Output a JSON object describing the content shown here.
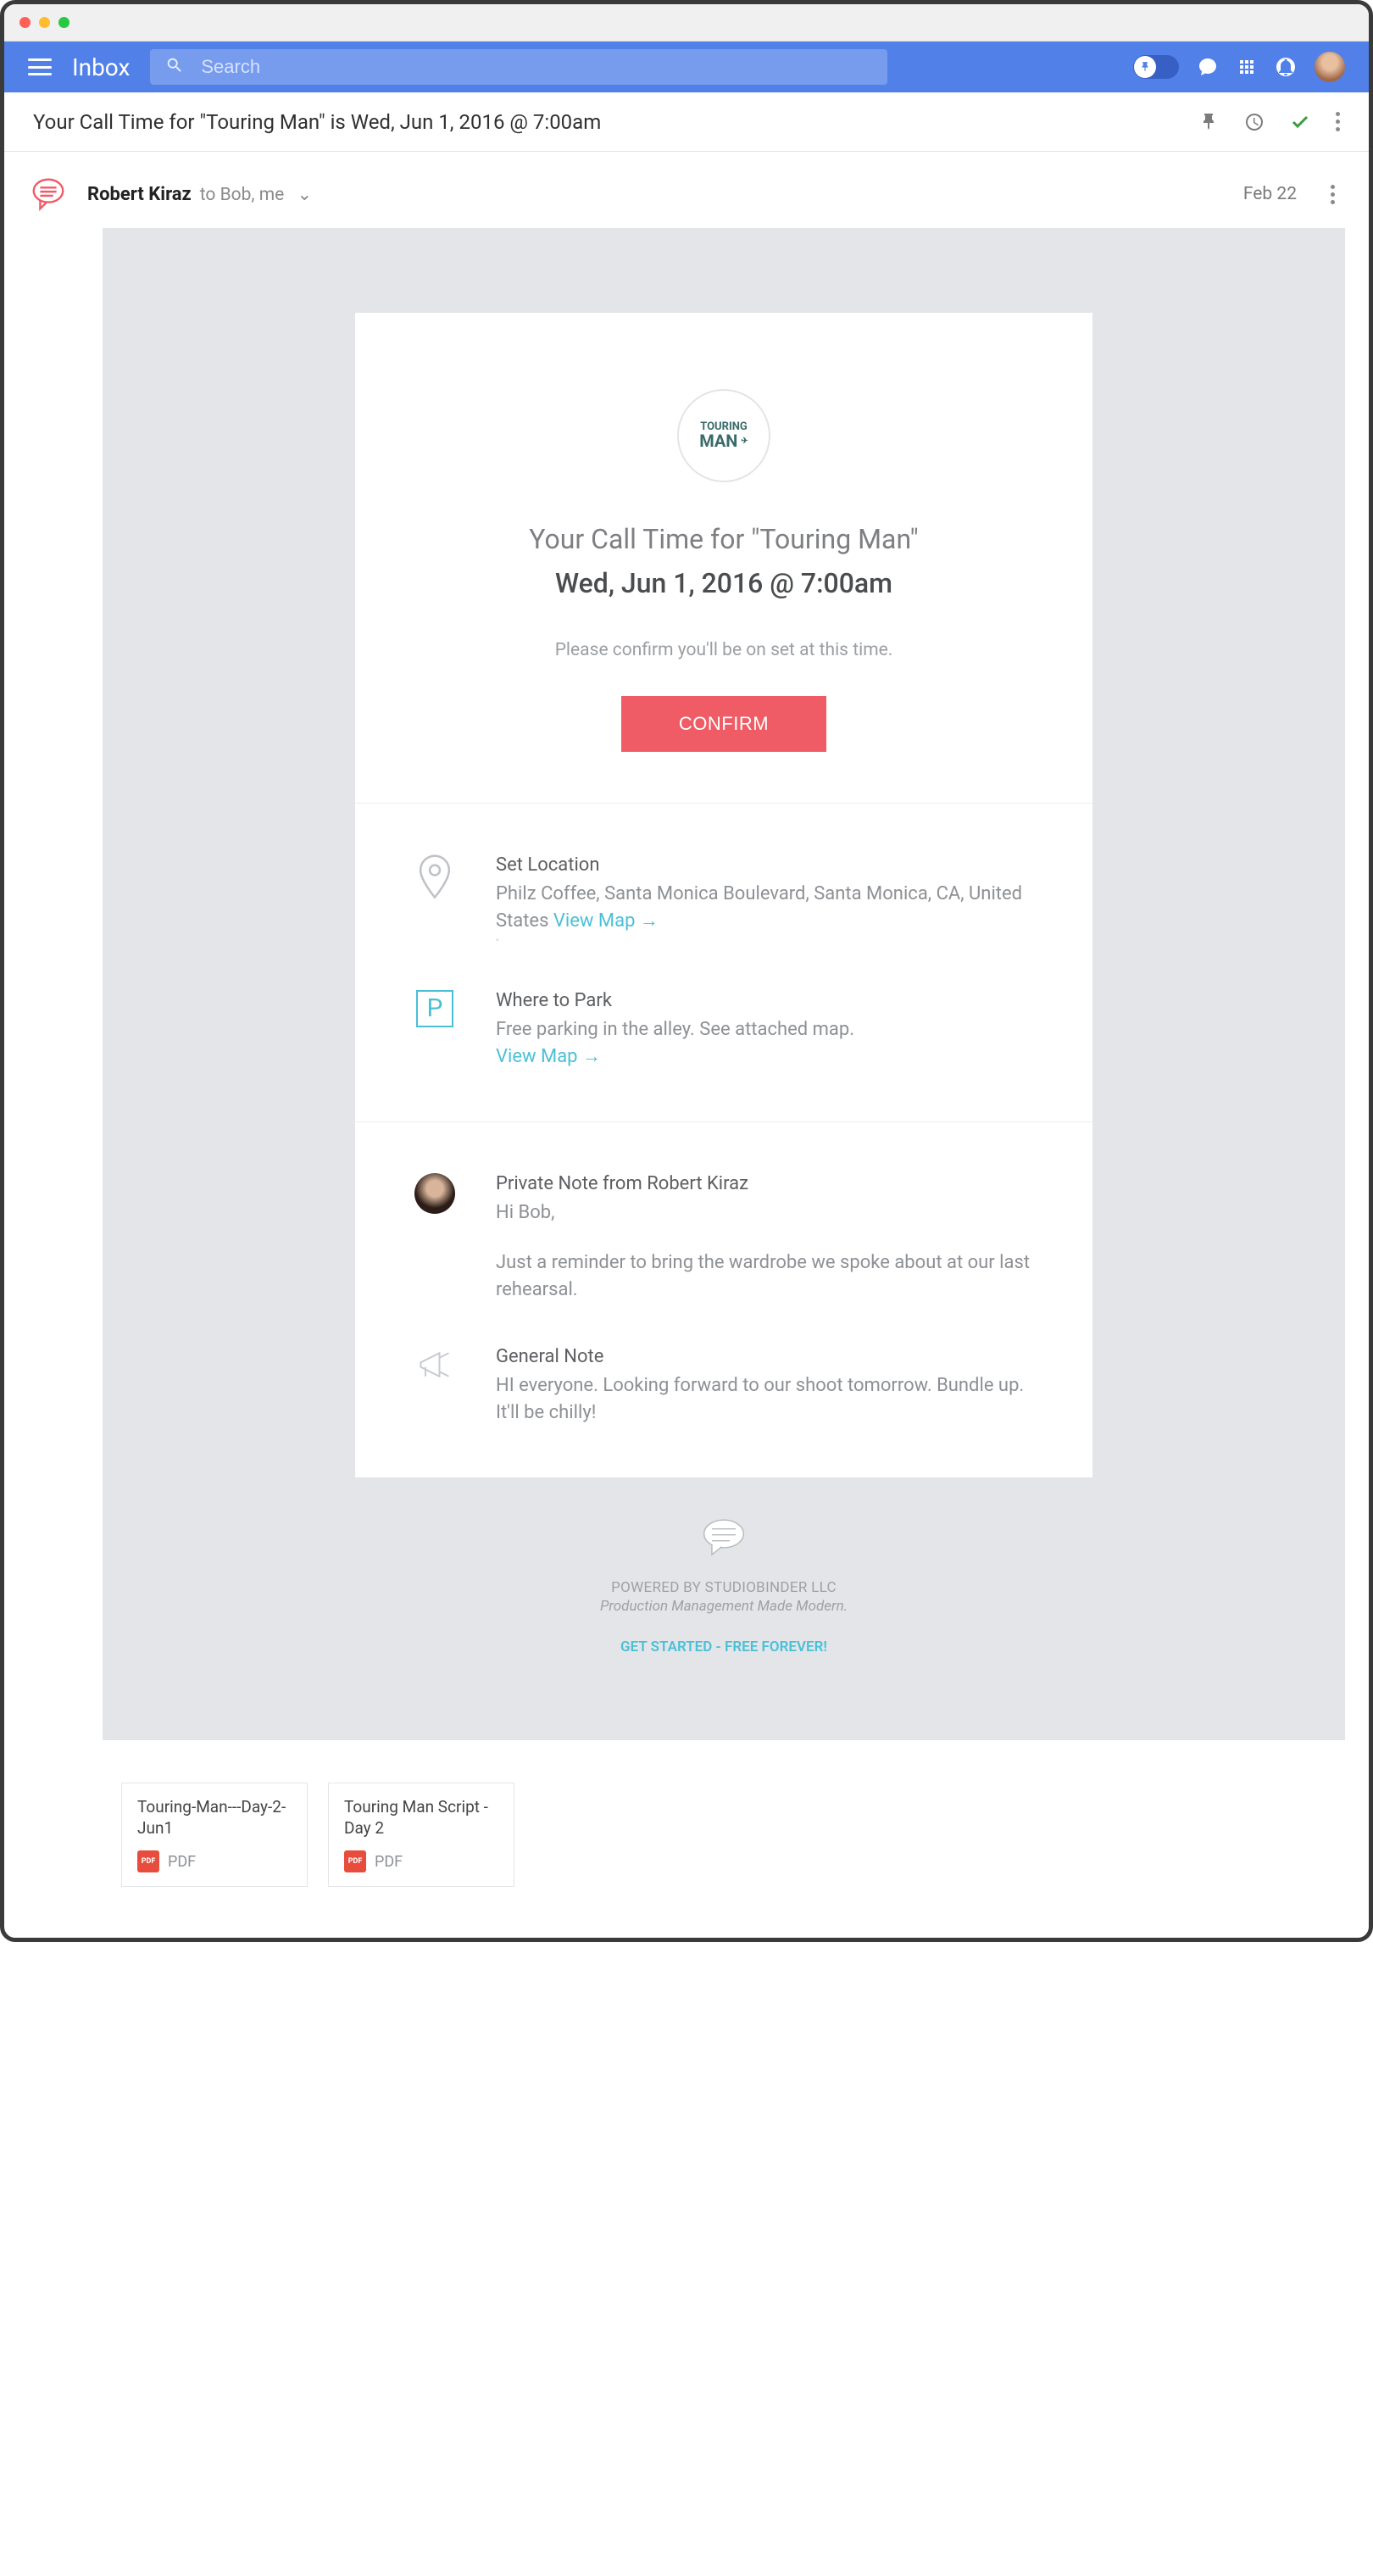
{
  "header": {
    "inbox_label": "Inbox",
    "search_placeholder": "Search"
  },
  "subject": "Your Call Time for \"Touring Man\" is Wed, Jun 1, 2016 @ 7:00am",
  "sender": {
    "name": "Robert Kiraz",
    "to": "to Bob, me",
    "date": "Feb 22"
  },
  "email": {
    "logo_top": "TOURING",
    "logo_bottom": "MAN",
    "title": "Your Call Time for \"Touring Man\"",
    "datetime": "Wed, Jun 1, 2016 @ 7:00am",
    "subtitle": "Please confirm you'll be on set at this time.",
    "confirm_label": "CONFIRM",
    "location": {
      "label": "Set Location",
      "text": "Philz Coffee, Santa Monica Boulevard, Santa Monica, CA, United States ",
      "map_link": "View Map →"
    },
    "park": {
      "label": "Where to Park",
      "text": "Free parking in the alley. See attached map.",
      "map_link": "View Map →",
      "p_letter": "P"
    },
    "private_note": {
      "label": "Private Note from Robert Kiraz",
      "greeting": "Hi Bob,",
      "body": "Just a reminder to bring the wardrobe we spoke about at our last rehearsal."
    },
    "general_note": {
      "label": "General Note",
      "body": "HI everyone. Looking forward to our shoot tomorrow. Bundle up. It'll be chilly!"
    },
    "footer": {
      "powered": "POWERED BY STUDIOBINDER LLC",
      "tagline": "Production Management Made Modern.",
      "cta": "GET STARTED - FREE FOREVER!"
    }
  },
  "attachments": [
    {
      "title": "Touring-Man---Day-2-Jun1",
      "type": "PDF",
      "badge": "PDF"
    },
    {
      "title": "Touring Man Script - Day 2",
      "type": "PDF",
      "badge": "PDF"
    }
  ]
}
